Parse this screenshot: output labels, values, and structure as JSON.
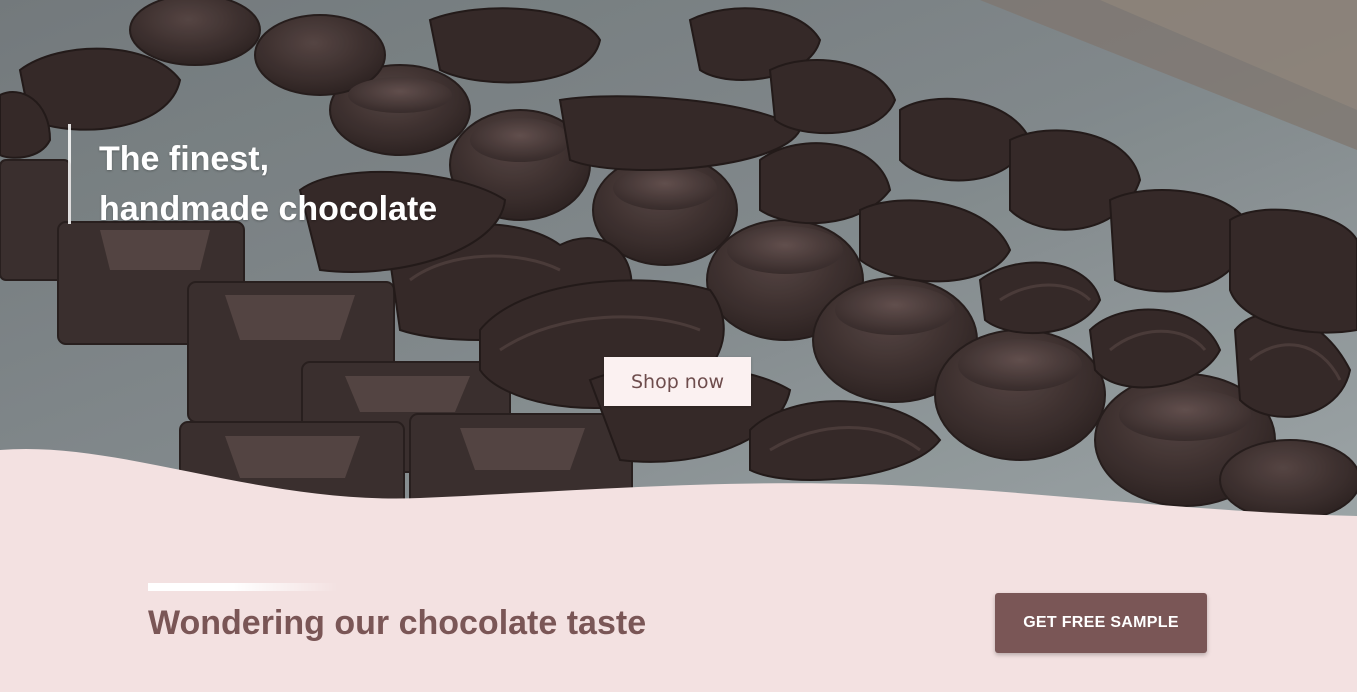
{
  "hero": {
    "image": "chocolate-pralines-photo",
    "title_line1": "The finest,",
    "title_line2": "handmade chocolate",
    "cta_label": "Shop now"
  },
  "taste_section": {
    "heading": "Wondering our chocolate taste",
    "cta_label": "GET FREE SAMPLE"
  },
  "colors": {
    "background_pink": "#f3e1e1",
    "brand_brown": "#7a5656",
    "shop_button_bg": "#fbf1f1"
  }
}
